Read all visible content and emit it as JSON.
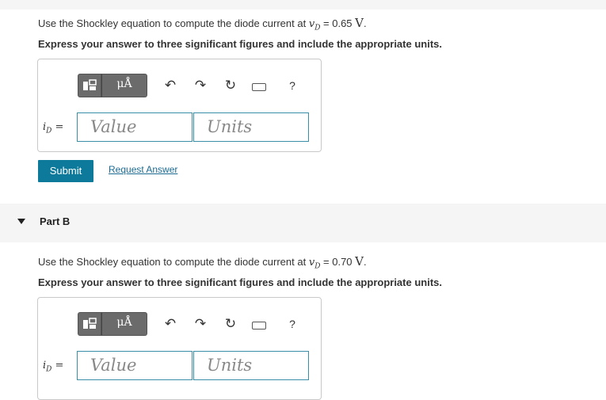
{
  "partA": {
    "prompt_text": "Use the Shockley equation to compute the diode current at ",
    "variable": "vD",
    "equals_value": "= 0.65",
    "unit": "V",
    "period": ".",
    "instruction": "Express your answer to three significant figures and include the appropriate units.",
    "answer_label": "iD =",
    "value_placeholder": "Value",
    "units_placeholder": "Units",
    "toolbar": {
      "units_button": "μÅ",
      "help": "?"
    },
    "submit_label": "Submit",
    "request_answer_label": "Request Answer"
  },
  "partB": {
    "title": "Part B",
    "prompt_text": "Use the Shockley equation to compute the diode current at ",
    "variable": "vD",
    "equals_value": "= 0.70",
    "unit": "V",
    "period": ".",
    "instruction": "Express your answer to three significant figures and include the appropriate units.",
    "answer_label": "iD =",
    "value_placeholder": "Value",
    "units_placeholder": "Units",
    "toolbar": {
      "units_button": "μÅ",
      "help": "?"
    }
  },
  "colors": {
    "accent": "#0e7a9b",
    "link": "#1c6b93",
    "field_border": "#3b8ea8"
  },
  "icons": [
    "templates-icon",
    "units-icon",
    "undo-icon",
    "redo-icon",
    "reset-icon",
    "keyboard-icon",
    "help-icon",
    "collapse-caret-icon"
  ]
}
